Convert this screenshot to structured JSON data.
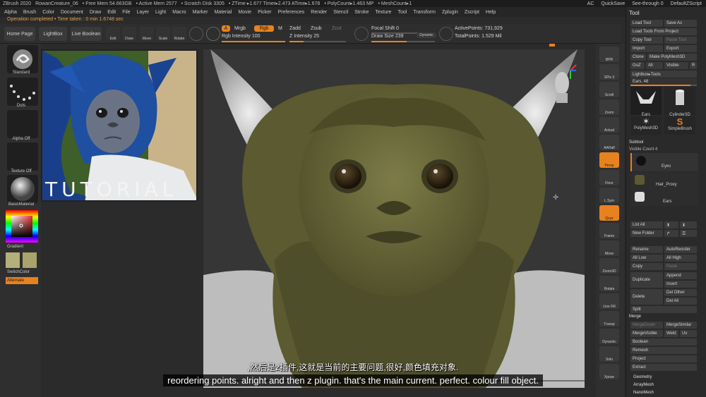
{
  "titlebar": {
    "app": "ZBrush 2020",
    "file": "RowanCreature_06",
    "free_mem": "• Free Mem 54.663GB",
    "active_mem": "• Active Mem 2577",
    "scratch": "• Scratch Disk 3305",
    "ztime": "• ZTime ▸1.677 Timer▸2.473 ATime▸1.678",
    "polycount": "• PolyCount▸1.463 MP",
    "meshcount": "• MeshCount▸1",
    "ac": "AC",
    "quicksave": "QuickSave",
    "seethrough": "See-through 0",
    "script": "DefaultZScript"
  },
  "menu": [
    "Alpha",
    "Brush",
    "Color",
    "Document",
    "Draw",
    "Edit",
    "File",
    "Layer",
    "Light",
    "Macro",
    "Marker",
    "Material",
    "Movie",
    "Picker",
    "Preferences",
    "Render",
    "Stencil",
    "Stroke",
    "Texture",
    "Tool",
    "Transform",
    "Zplugin",
    "Zscript",
    "Help"
  ],
  "notice": "Operation completed • Time taken : 0 min 1.6748 sec",
  "toolbar": {
    "home": "Home Page",
    "lightbox": "LightBox",
    "livebool": "Live Boolean",
    "edit": "Edit",
    "draw": "Draw",
    "move": "Move",
    "scale": "Scale",
    "rotate": "Rotate",
    "a": "A",
    "mrgb": "Mrgb",
    "rgb": "Rgb",
    "m": "M",
    "zadd": "Zadd",
    "zsub": "Zsub",
    "zcut": "Zcut",
    "rgb_int_label": "Rgb Intensity",
    "rgb_int_value": "100",
    "rgb_int_level": 1.0,
    "z_int_label": "Z Intensity",
    "z_int_value": "25",
    "z_int_level": 0.25,
    "focal_label": "Focal Shift",
    "focal_value": "0",
    "draw_size_label": "Draw Size",
    "draw_size_value": "239",
    "dynamic": "Dynamic",
    "active_points": "ActivePoints: 731,929",
    "total_points": "TotalPoints: 1.529 Mil"
  },
  "leftshelf": {
    "standard": "Standard",
    "dots": "Dots",
    "alpha_off": "Alpha Off",
    "texture_off": "Texture Off",
    "basic_material": "BasicMaterial",
    "gradient": "Gradient",
    "switch_color": "SwitchColor",
    "alternate": "Alternate"
  },
  "reference_caption": "TUTORIAL",
  "rightstrip": [
    "BPR",
    "SPix 3",
    "Scroll",
    "Zoom",
    "Actual",
    "AAHalf",
    "Persp",
    "Floor",
    "L.Sym",
    "Qxyz",
    "Frame",
    "Move",
    "Zoom3D",
    "Rotate",
    "Line Fill",
    "Transp",
    "Dynamic",
    "Solo",
    "Xpose"
  ],
  "panel": {
    "title": "Tool",
    "load_tool": "Load Tool",
    "save_as": "Save As",
    "load_from_project": "Load Tools From Project",
    "copy_tool": "Copy Tool",
    "paste_tool": "Paste Tool",
    "import": "Import",
    "export": "Export",
    "clone": "Clone",
    "make_polymesh": "Make PolyMesh3D",
    "goz": "GoZ",
    "all": "All",
    "visible": "Visible",
    "r": "R",
    "lightbox_tools": "Lightbox▸Tools",
    "ears_label": "Ears. 48",
    "ears_level": 0.9,
    "thumbs": [
      "Ears",
      "Cylinder3D",
      "PolyMesh3D",
      "SimpleBrush"
    ],
    "subtool": "Subtool",
    "visible_count": "Visible Count 4",
    "subtools": [
      "Eyes",
      "Hair_Proxy",
      "Ears"
    ],
    "list_all": "List All",
    "new_folder": "New Folder",
    "rename": "Rename",
    "autoreorder": "AutoReorder",
    "all_low": "All Low",
    "all_high": "All High",
    "copy": "Copy",
    "paste": "Paste",
    "duplicate": "Duplicate",
    "append": "Append",
    "insert": "Insert",
    "delete": "Delete",
    "del_other": "Del Other",
    "del_all": "Del All",
    "split": "Split",
    "merge": "Merge",
    "merge_down": "MergeDown",
    "merge_similar": "MergeSimilar",
    "merge_visible": "MergeVisible",
    "weld": "Weld",
    "uv": "Uv",
    "boolean": "Boolean",
    "remesh": "Remesh",
    "project": "Project",
    "extract": "Extract",
    "geometry": "Geometry",
    "arraymesh": "ArrayMesh",
    "nanomesh": "NanoMesh"
  },
  "subtitle": {
    "cn": ",然后是z插件,这就是当前的主要问题,很好,颜色填充对象.",
    "en": "reordering points. alright and then z plugin. that's the main current. perfect. colour fill object."
  },
  "colors": {
    "accent": "#e8821e",
    "creature": "#6b6b3a",
    "hair": "#1d4e9a"
  }
}
